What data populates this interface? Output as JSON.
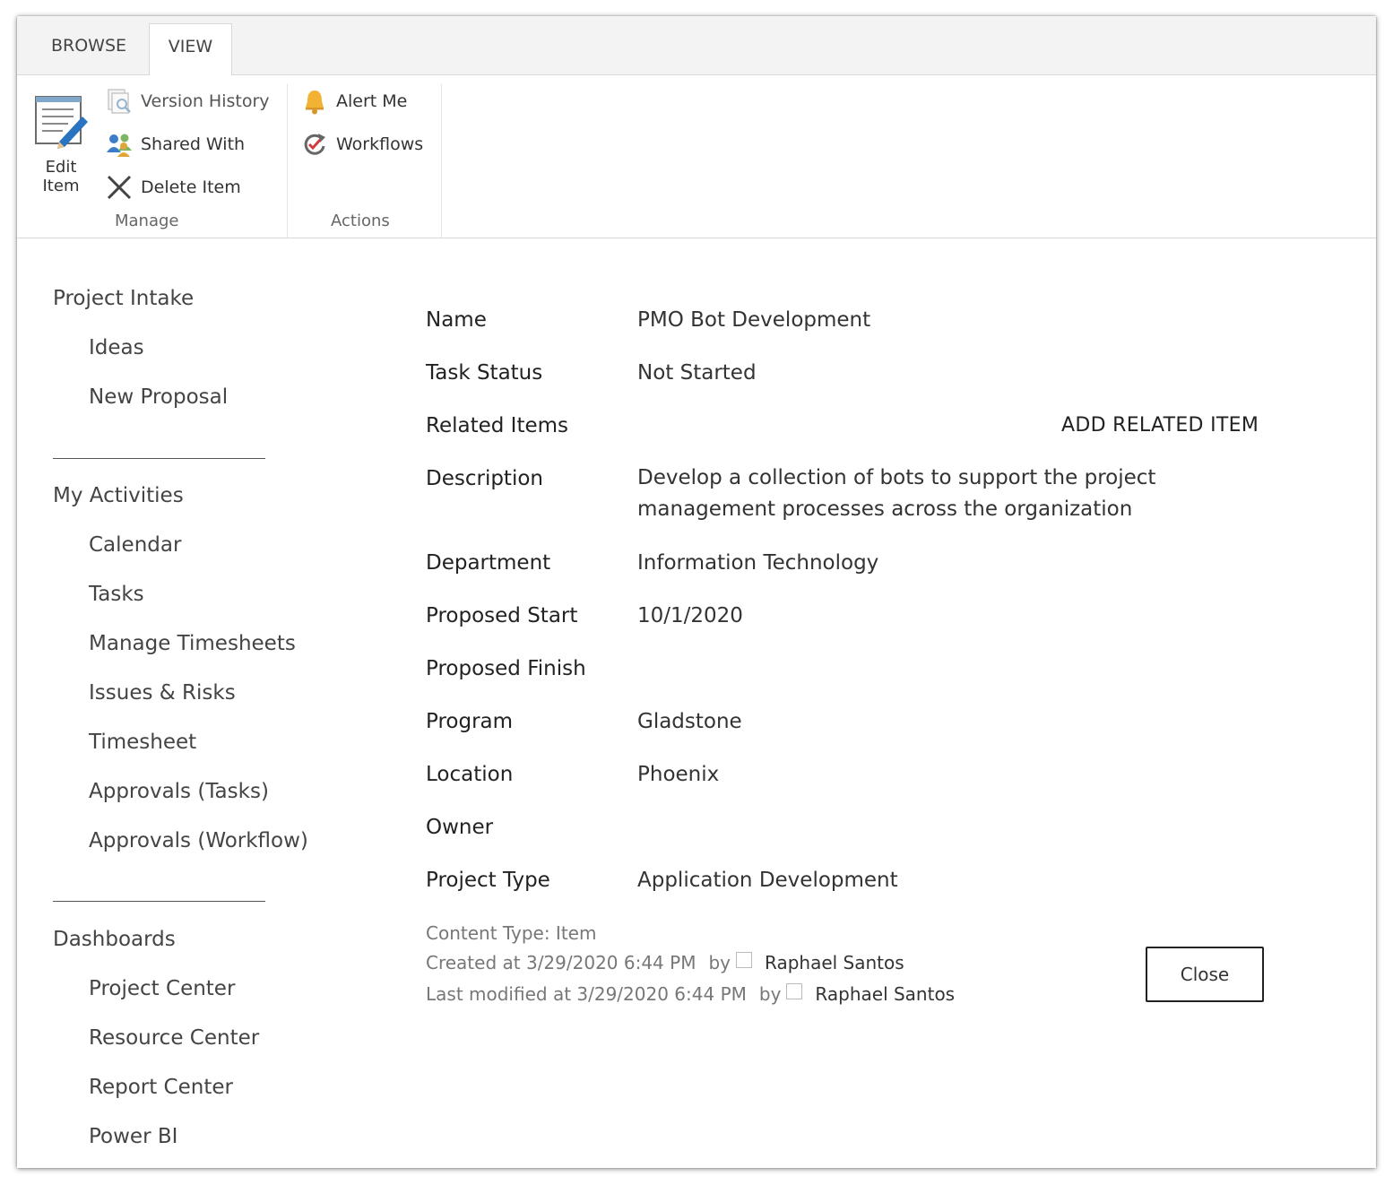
{
  "ribbon": {
    "tabs": [
      {
        "label": "BROWSE"
      },
      {
        "label": "VIEW"
      }
    ],
    "manage": {
      "edit_item_line1": "Edit",
      "edit_item_line2": "Item",
      "version_history": "Version History",
      "shared_with": "Shared With",
      "delete_item": "Delete Item",
      "group_label": "Manage"
    },
    "actions": {
      "alert_me": "Alert Me",
      "workflows": "Workflows",
      "group_label": "Actions"
    }
  },
  "nav": {
    "sections": [
      {
        "heading": "Project Intake",
        "items": [
          "Ideas",
          "New Proposal"
        ]
      },
      {
        "heading": "My Activities",
        "items": [
          "Calendar",
          "Tasks",
          "Manage Timesheets",
          "Issues & Risks",
          "Timesheet",
          "Approvals (Tasks)",
          "Approvals (Workflow)"
        ]
      },
      {
        "heading": "Dashboards",
        "items": [
          "Project Center",
          "Resource Center",
          "Report Center",
          "Power BI"
        ]
      }
    ]
  },
  "form": {
    "fields": [
      {
        "label": "Name",
        "value": "PMO Bot Development"
      },
      {
        "label": "Task Status",
        "value": "Not Started"
      },
      {
        "label": "Related Items",
        "value": ""
      },
      {
        "label": "Description",
        "value": "Develop a collection of bots to support the project management processes across the organization"
      },
      {
        "label": "Department",
        "value": "Information Technology"
      },
      {
        "label": "Proposed Start",
        "value": "10/1/2020"
      },
      {
        "label": "Proposed Finish",
        "value": ""
      },
      {
        "label": "Program",
        "value": "Gladstone"
      },
      {
        "label": "Location",
        "value": "Phoenix"
      },
      {
        "label": "Owner",
        "value": ""
      },
      {
        "label": "Project Type",
        "value": "Application Development"
      }
    ],
    "add_related_item": "ADD RELATED ITEM"
  },
  "meta": {
    "content_type": "Content Type: Item",
    "created_at": "Created at 3/29/2020 6:44 PM",
    "modified_at": "Last modified at 3/29/2020 6:44 PM",
    "by": "by",
    "created_by": "Raphael Santos",
    "modified_by": "Raphael Santos"
  },
  "buttons": {
    "close": "Close"
  },
  "colors": {
    "ribbon_bg": "#f3f3f3",
    "border": "#d8d8d8",
    "text": "#333333",
    "muted": "#777777"
  }
}
